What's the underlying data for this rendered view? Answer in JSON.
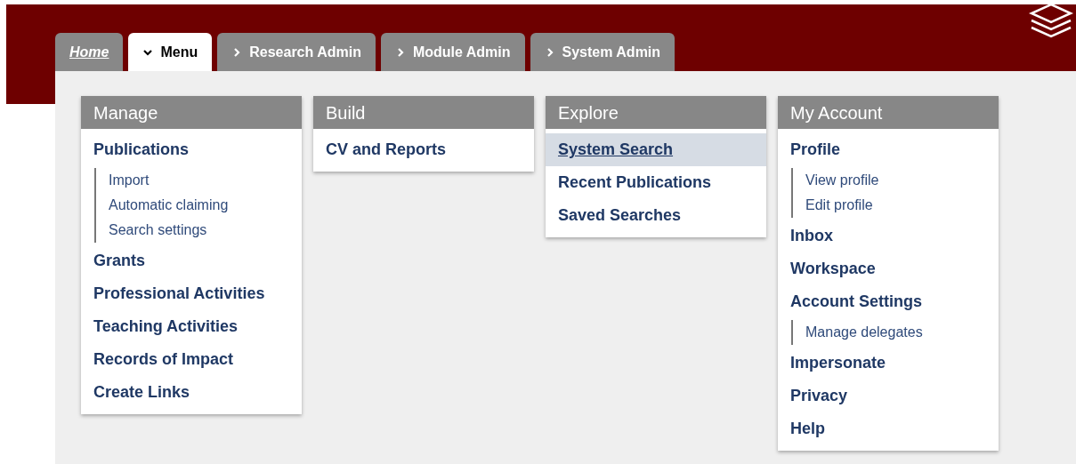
{
  "tabs": [
    {
      "label": "Home",
      "kind": "link",
      "selected": false
    },
    {
      "label": "Menu",
      "kind": "dropdown",
      "selected": true,
      "expanded": true
    },
    {
      "label": "Research Admin",
      "kind": "dropdown",
      "selected": false,
      "expanded": false
    },
    {
      "label": "Module Admin",
      "kind": "dropdown",
      "selected": false,
      "expanded": false
    },
    {
      "label": "System Admin",
      "kind": "dropdown",
      "selected": false,
      "expanded": false
    }
  ],
  "menu_columns": [
    {
      "title": "Manage",
      "items": [
        {
          "label": "Publications",
          "selected": false,
          "children": [
            {
              "label": "Import",
              "selected": false
            },
            {
              "label": "Automatic claiming",
              "selected": false
            },
            {
              "label": "Search settings",
              "selected": false
            }
          ]
        },
        {
          "label": "Grants",
          "selected": false
        },
        {
          "label": "Professional Activities",
          "selected": false
        },
        {
          "label": "Teaching Activities",
          "selected": false
        },
        {
          "label": "Records of Impact",
          "selected": false
        },
        {
          "label": "Create Links",
          "selected": false
        }
      ]
    },
    {
      "title": "Build",
      "items": [
        {
          "label": "CV and Reports",
          "selected": false
        }
      ]
    },
    {
      "title": "Explore",
      "items": [
        {
          "label": "System Search",
          "selected": true
        },
        {
          "label": "Recent Publications",
          "selected": false
        },
        {
          "label": "Saved Searches",
          "selected": false
        }
      ]
    },
    {
      "title": "My Account",
      "items": [
        {
          "label": "Profile",
          "selected": false,
          "children": [
            {
              "label": "View profile",
              "selected": false
            },
            {
              "label": "Edit profile",
              "selected": false
            }
          ]
        },
        {
          "label": "Inbox",
          "selected": false
        },
        {
          "label": "Workspace",
          "selected": false
        },
        {
          "label": "Account Settings",
          "selected": false,
          "children": [
            {
              "label": "Manage delegates",
              "selected": false
            }
          ]
        },
        {
          "label": "Impersonate",
          "selected": false
        },
        {
          "label": "Privacy",
          "selected": false
        },
        {
          "label": "Help",
          "selected": false
        }
      ]
    }
  ]
}
